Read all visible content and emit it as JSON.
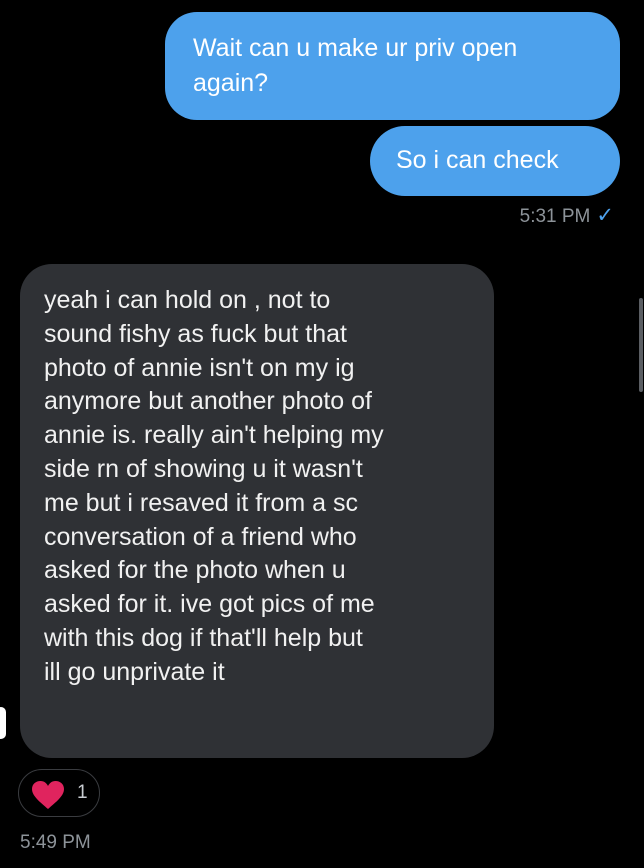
{
  "messages": [
    {
      "direction": "sent",
      "text": "Wait can u make ur priv open\nagain?"
    },
    {
      "direction": "sent",
      "text": "So i can check"
    },
    {
      "direction": "received",
      "text": "yeah i can hold on , not to\nsound fishy as fuck but that\nphoto of annie isn't on my ig\nanymore but another photo of\nannie is. really ain't helping my\nside rn of showing u it wasn't\nme but i resaved it from a sc\nconversation of a friend who\nasked for the photo when u\nasked for it. ive got pics of me\nwith this dog if that'll help but\nill go unprivate it"
    }
  ],
  "timestamps": {
    "sent": "5:31 PM",
    "sent_status_icon": "checkmark-icon",
    "received": "5:49 PM"
  },
  "reaction": {
    "icon": "heart-icon",
    "count": "1"
  },
  "colors": {
    "background": "#000000",
    "sent_bubble": "#4da1ec",
    "received_bubble": "#2f3135",
    "timestamp": "#8d9399",
    "heart": "#e0245e"
  }
}
